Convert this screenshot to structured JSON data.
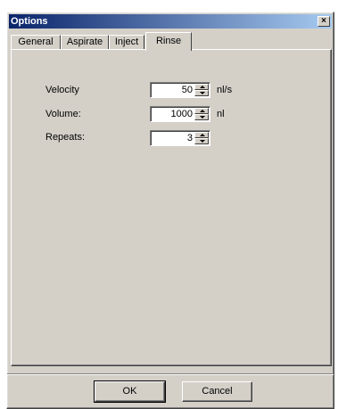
{
  "window": {
    "title": "Options",
    "close_glyph": "×"
  },
  "tabs": [
    {
      "label": "General",
      "active": false
    },
    {
      "label": "Aspirate",
      "active": false
    },
    {
      "label": "Inject",
      "active": false
    },
    {
      "label": "Rinse",
      "active": true
    }
  ],
  "rinse": {
    "fields": [
      {
        "label": "Velocity",
        "value": "50",
        "unit": "nl/s"
      },
      {
        "label": "Volume:",
        "value": "1000",
        "unit": "nl"
      },
      {
        "label": "Repeats:",
        "value": "3",
        "unit": ""
      }
    ]
  },
  "buttons": {
    "ok": "OK",
    "cancel": "Cancel"
  },
  "colors": {
    "title_start": "#0a246a",
    "title_end": "#a6caf0",
    "face": "#d4d0c8"
  }
}
